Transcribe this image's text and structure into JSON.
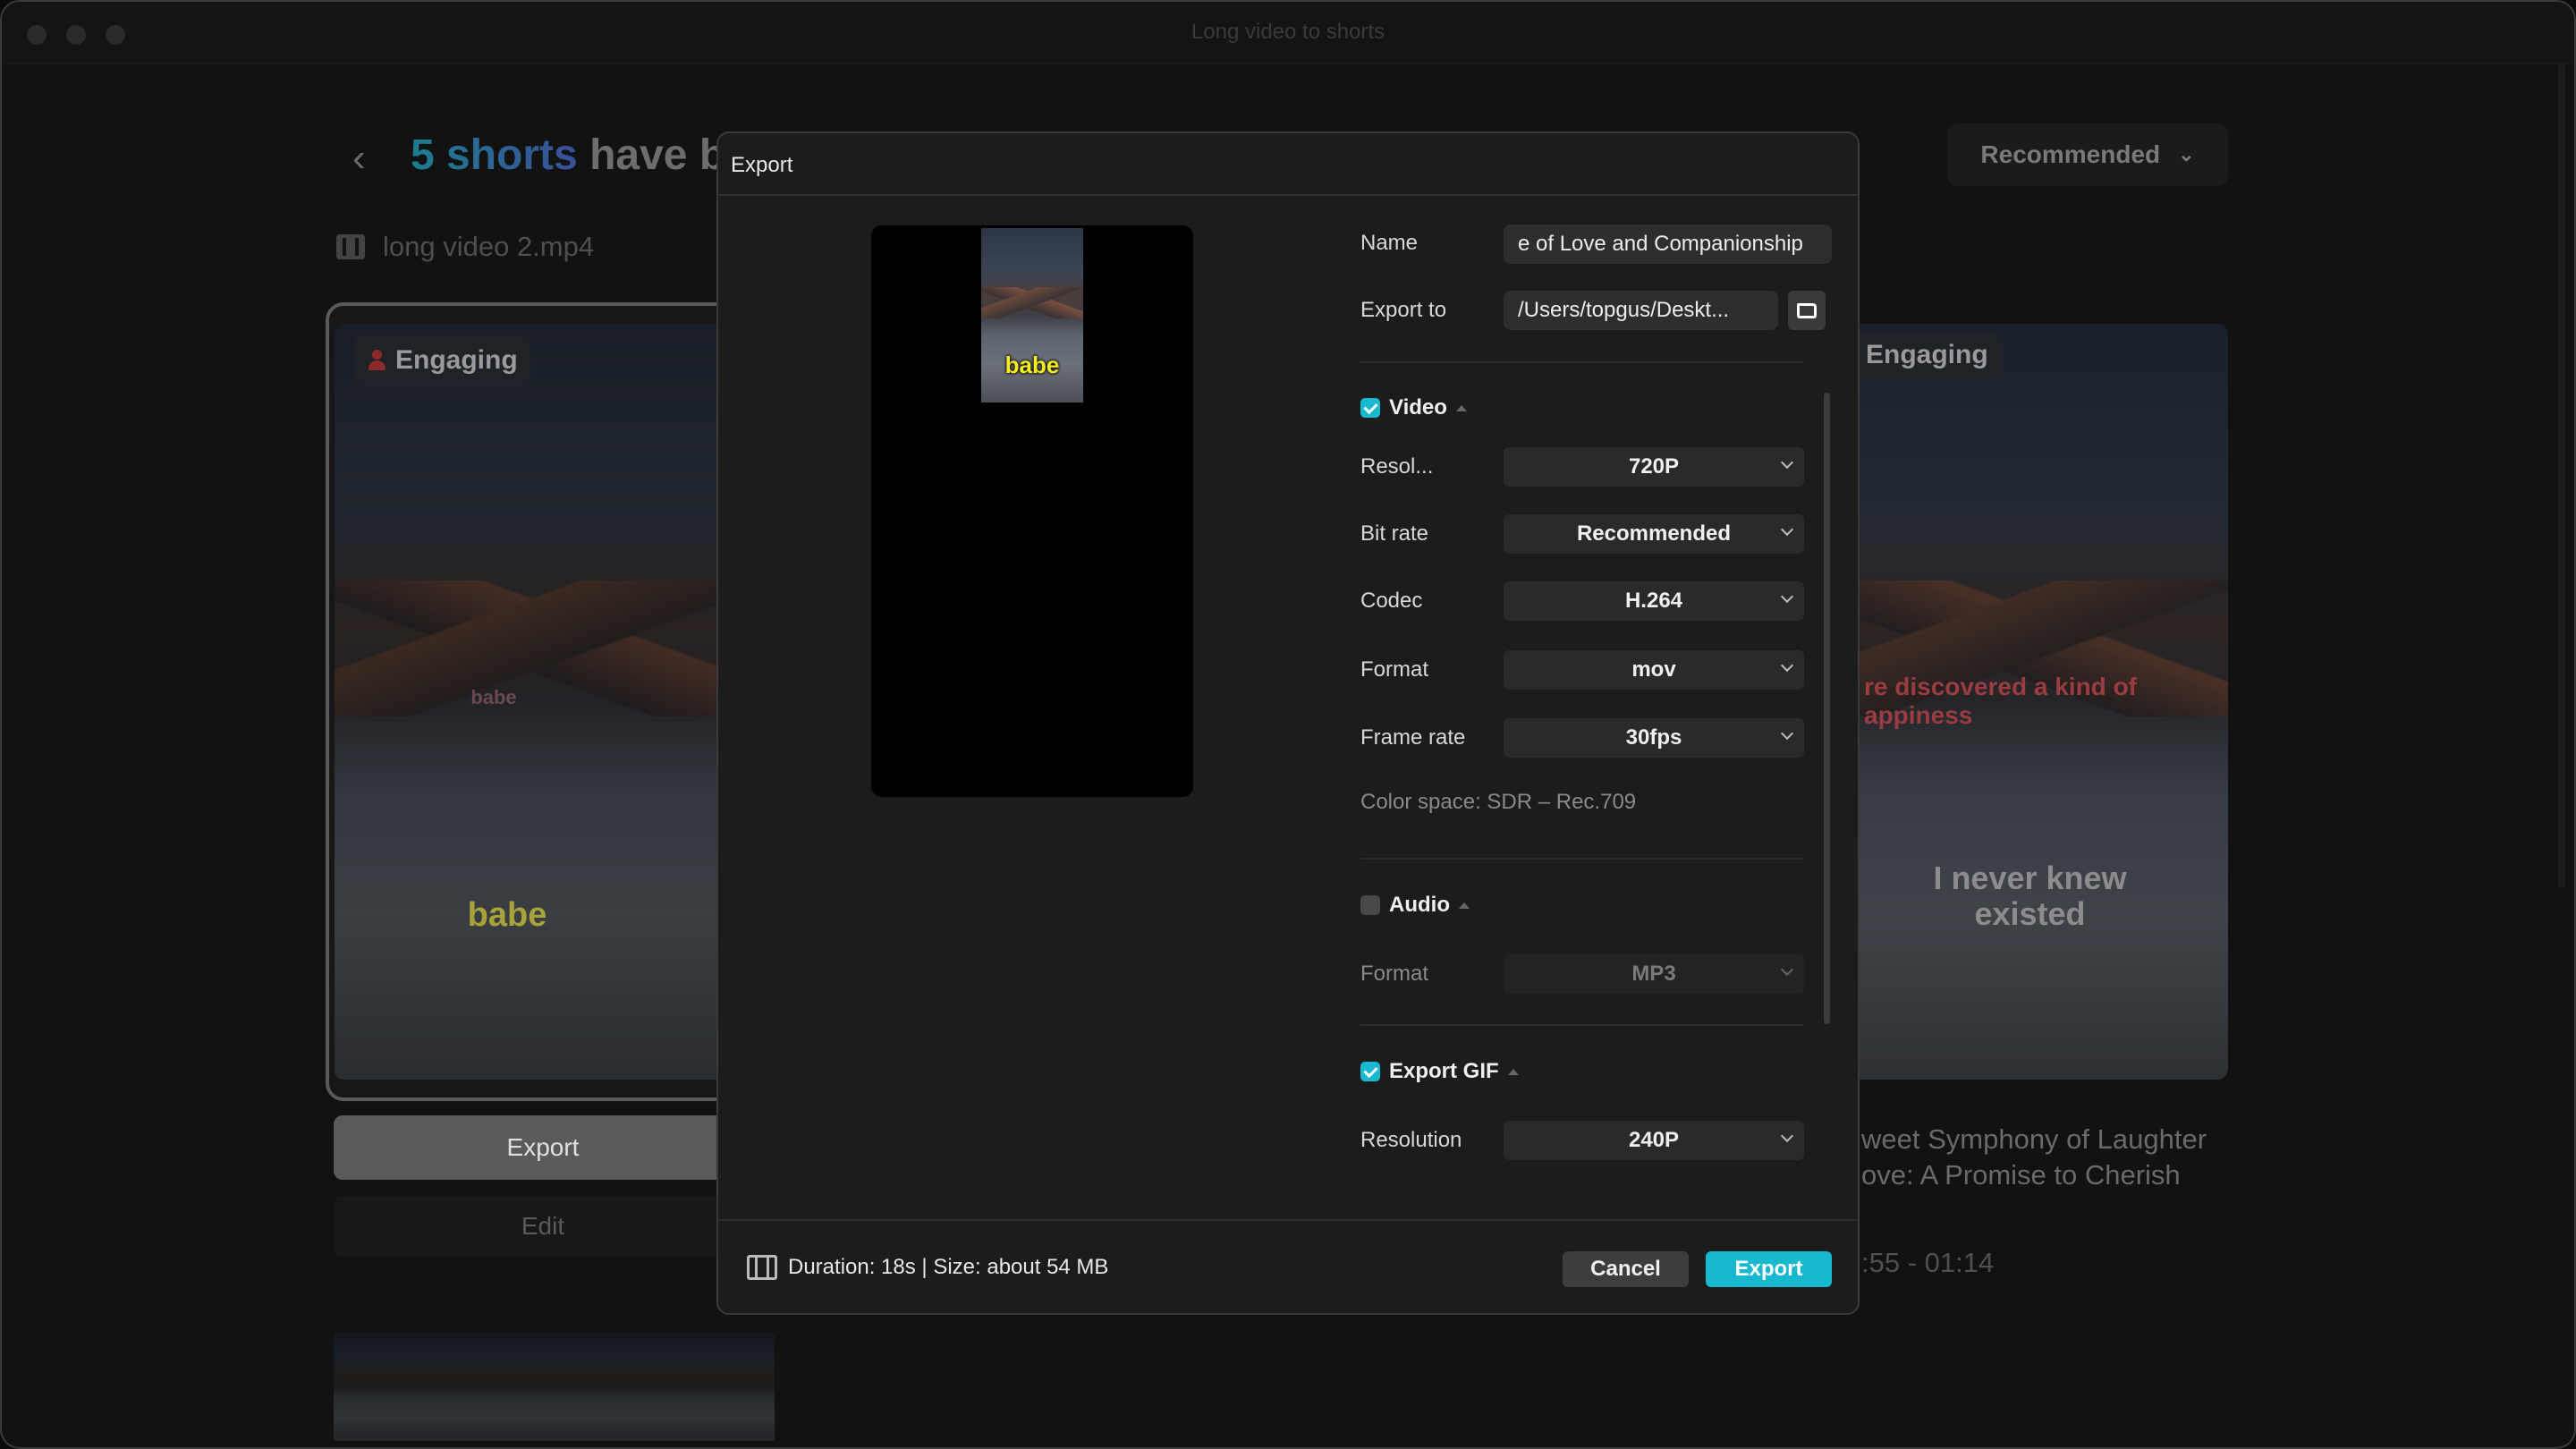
{
  "window": {
    "title": "Long video to shorts"
  },
  "page": {
    "heading_highlight": "5 shorts",
    "heading_rest": " have b",
    "source_file": "long video 2.mp4",
    "sort_button": "Recommended"
  },
  "cards": [
    {
      "badge": "Engaging",
      "subtitle_faint": "babe",
      "subtitle": "babe",
      "export_label": "Export",
      "edit_label": "Edit"
    },
    {
      "badge": "Engaging",
      "caption_red_1": "re discovered a kind of",
      "caption_red_2": "appiness",
      "subtitle_1": "I never knew",
      "subtitle_2": "existed",
      "title_line1": "weet Symphony of Laughter",
      "title_line2": "ove: A Promise to Cherish",
      "time_range": ":55 - 01:14"
    }
  ],
  "dialog": {
    "title": "Export",
    "preview_caption": "babe",
    "name_label": "Name",
    "name_value": "e of Love and Companionship",
    "export_to_label": "Export to",
    "export_to_value": "/Users/topgus/Deskt...",
    "video": {
      "label": "Video",
      "checked": true,
      "resolution_label": "Resol...",
      "resolution": "720P",
      "bitrate_label": "Bit rate",
      "bitrate": "Recommended",
      "codec_label": "Codec",
      "codec": "H.264",
      "format_label": "Format",
      "format": "mov",
      "framerate_label": "Frame rate",
      "framerate": "30fps",
      "color_space": "Color space: SDR – Rec.709"
    },
    "audio": {
      "label": "Audio",
      "checked": false,
      "format_label": "Format",
      "format": "MP3"
    },
    "gif": {
      "label": "Export GIF",
      "checked": true,
      "resolution_label": "Resolution",
      "resolution": "240P"
    },
    "footer_info": "Duration: 18s | Size: about 54 MB",
    "cancel": "Cancel",
    "export": "Export"
  },
  "colors": {
    "accent": "#18b8cf",
    "caption_yellow": "#f5ef1e"
  }
}
